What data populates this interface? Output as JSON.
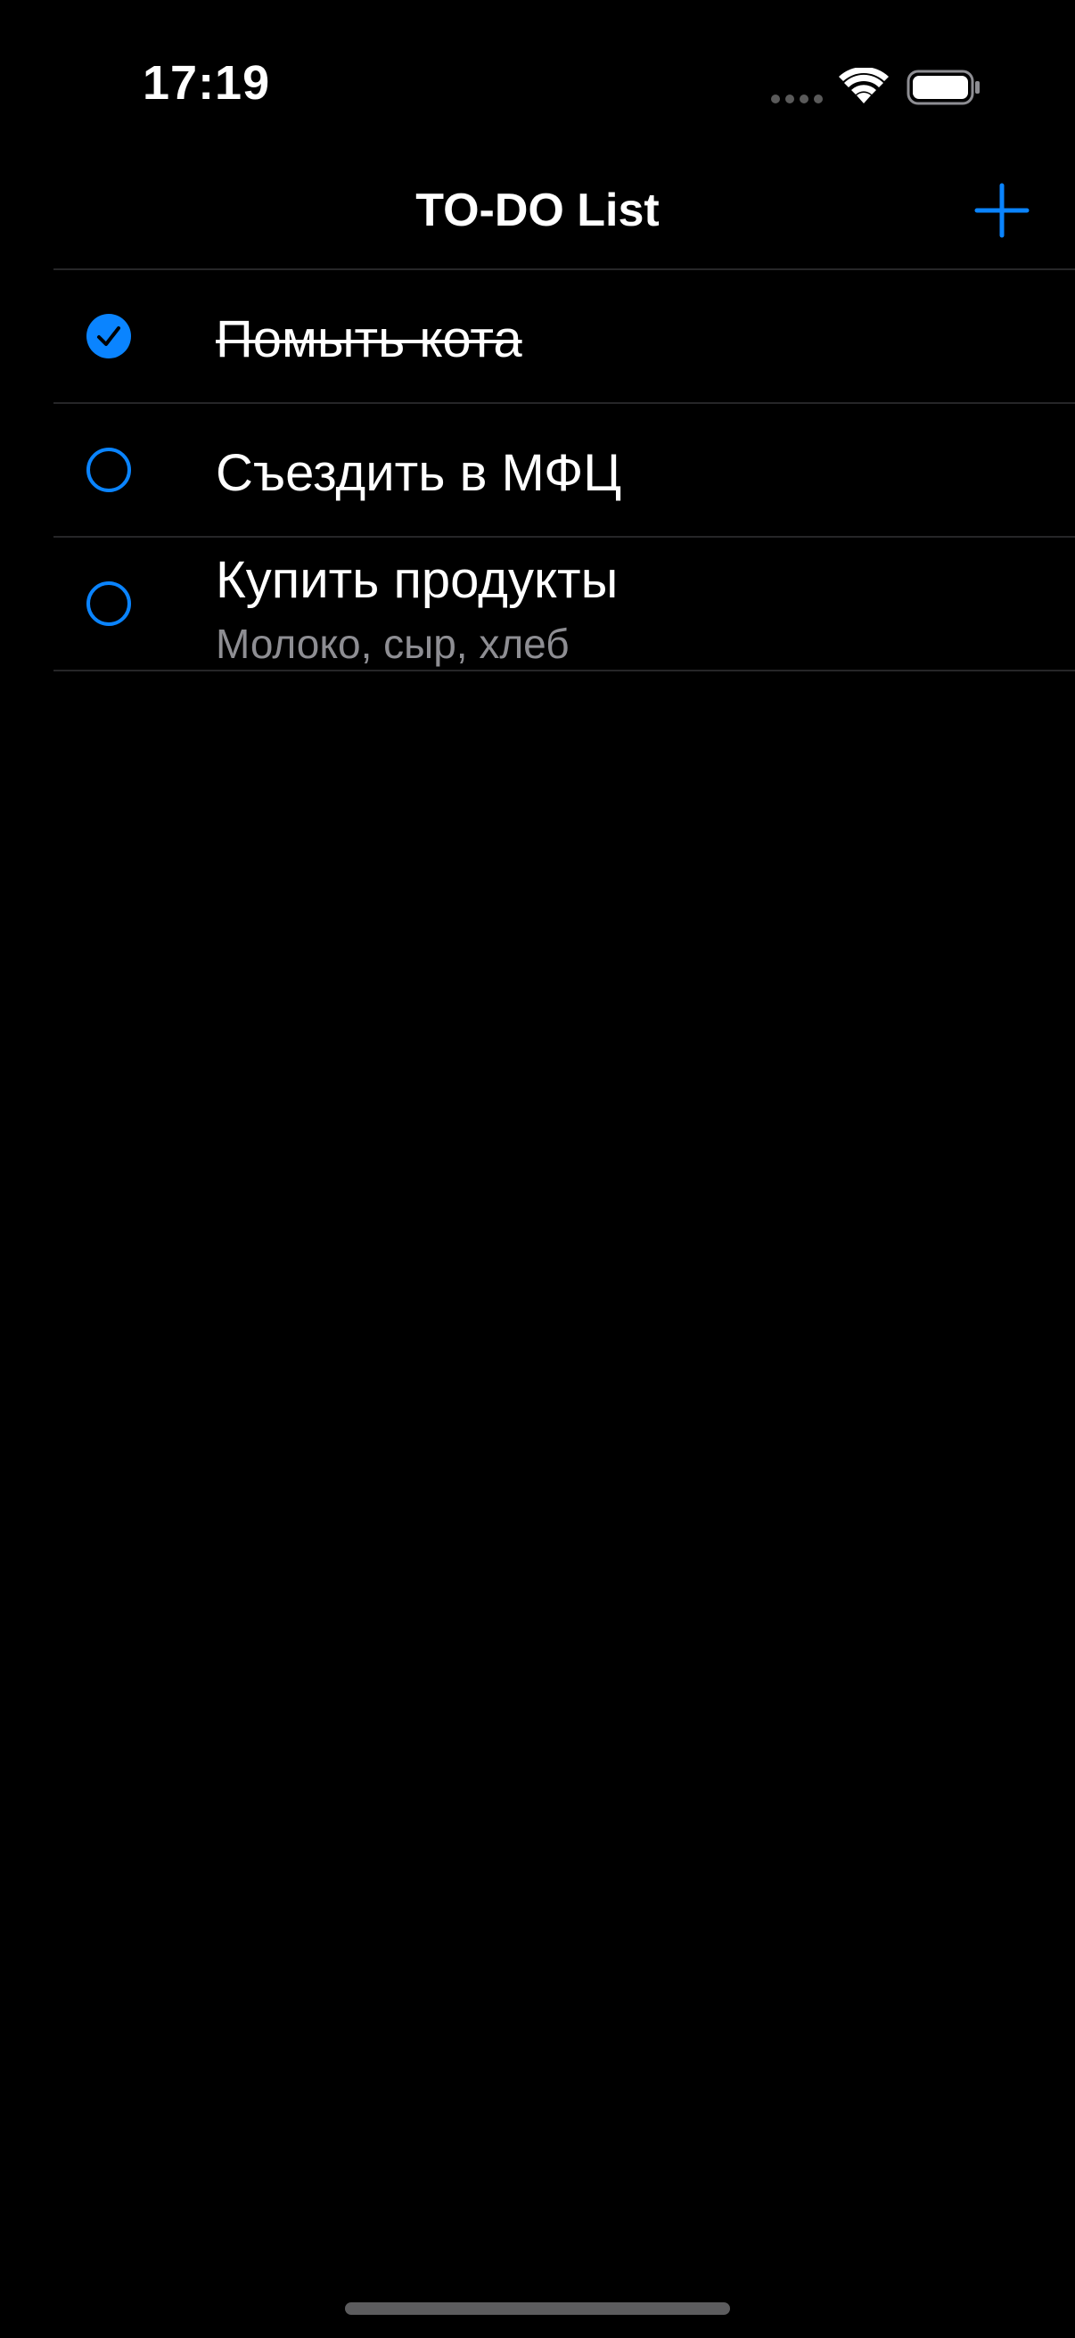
{
  "status_bar": {
    "time": "17:19",
    "icons": [
      "cellular-dots-icon",
      "wifi-icon",
      "battery-icon"
    ]
  },
  "nav": {
    "title": "TO-DO List",
    "add_icon": "plus-icon"
  },
  "colors": {
    "accent": "#0A84FF",
    "background": "#000000",
    "text": "#FFFFFF",
    "secondary_text": "#8E8E93",
    "separator": "#262628"
  },
  "todos": [
    {
      "title": "Помыть кота",
      "subtitle": "",
      "completed": true
    },
    {
      "title": "Съездить в МФЦ",
      "subtitle": "",
      "completed": false
    },
    {
      "title": "Купить продукты",
      "subtitle": "Молоко, сыр, хлеб",
      "completed": false
    }
  ]
}
